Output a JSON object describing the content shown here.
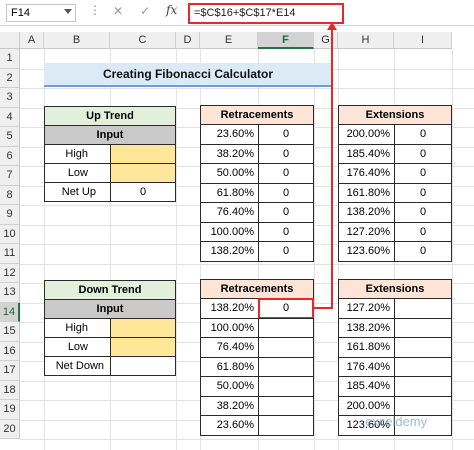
{
  "formula_bar": {
    "name_box": "F14",
    "dots": "⋮",
    "cancel": "✕",
    "enter": "✓",
    "fx": "fx",
    "formula": "=$C$16+$C$17*E14"
  },
  "columns": [
    "A",
    "B",
    "C",
    "D",
    "E",
    "F",
    "G",
    "H",
    "I"
  ],
  "rows": [
    "1",
    "2",
    "3",
    "4",
    "5",
    "6",
    "7",
    "8",
    "9",
    "10",
    "11",
    "12",
    "13",
    "14",
    "15",
    "16",
    "17",
    "18",
    "19",
    "20"
  ],
  "title": "Creating Fibonacci Calculator",
  "up_trend": {
    "header": "Up Trend",
    "input_header": "Input",
    "labels": [
      "High",
      "Low",
      "Net Up"
    ],
    "values": [
      "",
      "",
      "0"
    ]
  },
  "down_trend": {
    "header": "Down Trend",
    "input_header": "Input",
    "labels": [
      "High",
      "Low",
      "Net Down"
    ],
    "values": [
      "",
      "",
      ""
    ]
  },
  "retracements_top": {
    "header": "Retracements",
    "pcts": [
      "23.60%",
      "38.20%",
      "50.00%",
      "61.80%",
      "76.40%",
      "100.00%",
      "138.20%"
    ],
    "values": [
      "0",
      "0",
      "0",
      "0",
      "0",
      "0",
      "0"
    ]
  },
  "extensions_top": {
    "header": "Extensions",
    "pcts": [
      "200.00%",
      "185.40%",
      "176.40%",
      "161.80%",
      "138.20%",
      "127.20%",
      "123.60%"
    ],
    "values": [
      "0",
      "0",
      "0",
      "0",
      "0",
      "0",
      "0"
    ]
  },
  "retracements_bottom": {
    "header": "Retracements",
    "pcts": [
      "138.20%",
      "100.00%",
      "76.40%",
      "61.80%",
      "50.00%",
      "38.20%",
      "23.60%"
    ],
    "values": [
      "0",
      "",
      "",
      "",
      "",
      "",
      ""
    ]
  },
  "extensions_bottom": {
    "header": "Extensions",
    "pcts": [
      "127.20%",
      "138.20%",
      "161.80%",
      "176.40%",
      "185.40%",
      "200.00%",
      "123.60%"
    ],
    "values": [
      "",
      "",
      "",
      "",
      "",
      "",
      ""
    ]
  },
  "watermark": "exceldemy",
  "colors": {
    "accent_red": "#e8272a",
    "excel_green": "#217346",
    "input_yellow": "#ffe699"
  }
}
